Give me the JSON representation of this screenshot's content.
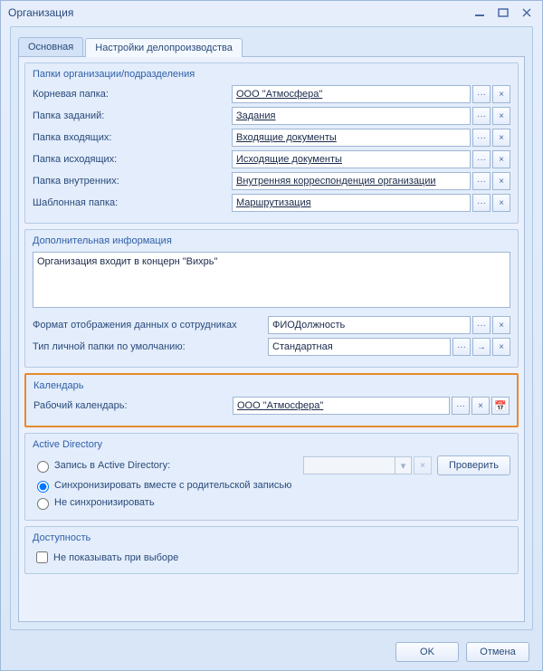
{
  "window": {
    "title": "Организация"
  },
  "tabs": {
    "main": "Основная",
    "settings": "Настройки делопроизводства"
  },
  "folders": {
    "title": "Папки организации/подразделения",
    "root_label": "Корневая папка:",
    "root_value": "ООО \"Атмосфера\"",
    "tasks_label": "Папка заданий:",
    "tasks_value": "Задания",
    "in_label": "Папка входящих:",
    "in_value": "Входящие документы",
    "out_label": "Папка исходящих:",
    "out_value": "Исходящие документы",
    "inner_label": "Папка внутренних:",
    "inner_value": "Внутренняя корреспонденция организации",
    "tmpl_label": "Шаблонная папка:",
    "tmpl_value": "Маршрутизация"
  },
  "extra": {
    "title": "Дополнительная информация",
    "memo": "Организация входит в концерн \"Вихрь\"",
    "emp_format_label": "Формат отображения данных о сотрудниках",
    "emp_format_value": "ФИОДолжность",
    "personal_folder_label": "Тип личной папки по умолчанию:",
    "personal_folder_value": "Стандартная"
  },
  "calendar": {
    "title": "Календарь",
    "work_label": "Рабочий календарь:",
    "work_value": "ООО \"Атмосфера\""
  },
  "ad": {
    "title": "Active Directory",
    "opt_record": "Запись в Active Directory:",
    "opt_sync_parent": "Синхронизировать вместе с родительской записью",
    "opt_no_sync": "Не синхронизировать",
    "check_btn": "Проверить"
  },
  "avail": {
    "title": "Доступность",
    "hide_label": "Не показывать при выборе"
  },
  "glyphs": {
    "dots": "···",
    "x": "×",
    "arrow": "→",
    "cal": "📅"
  },
  "footer": {
    "ok": "OK",
    "cancel": "Отмена"
  }
}
